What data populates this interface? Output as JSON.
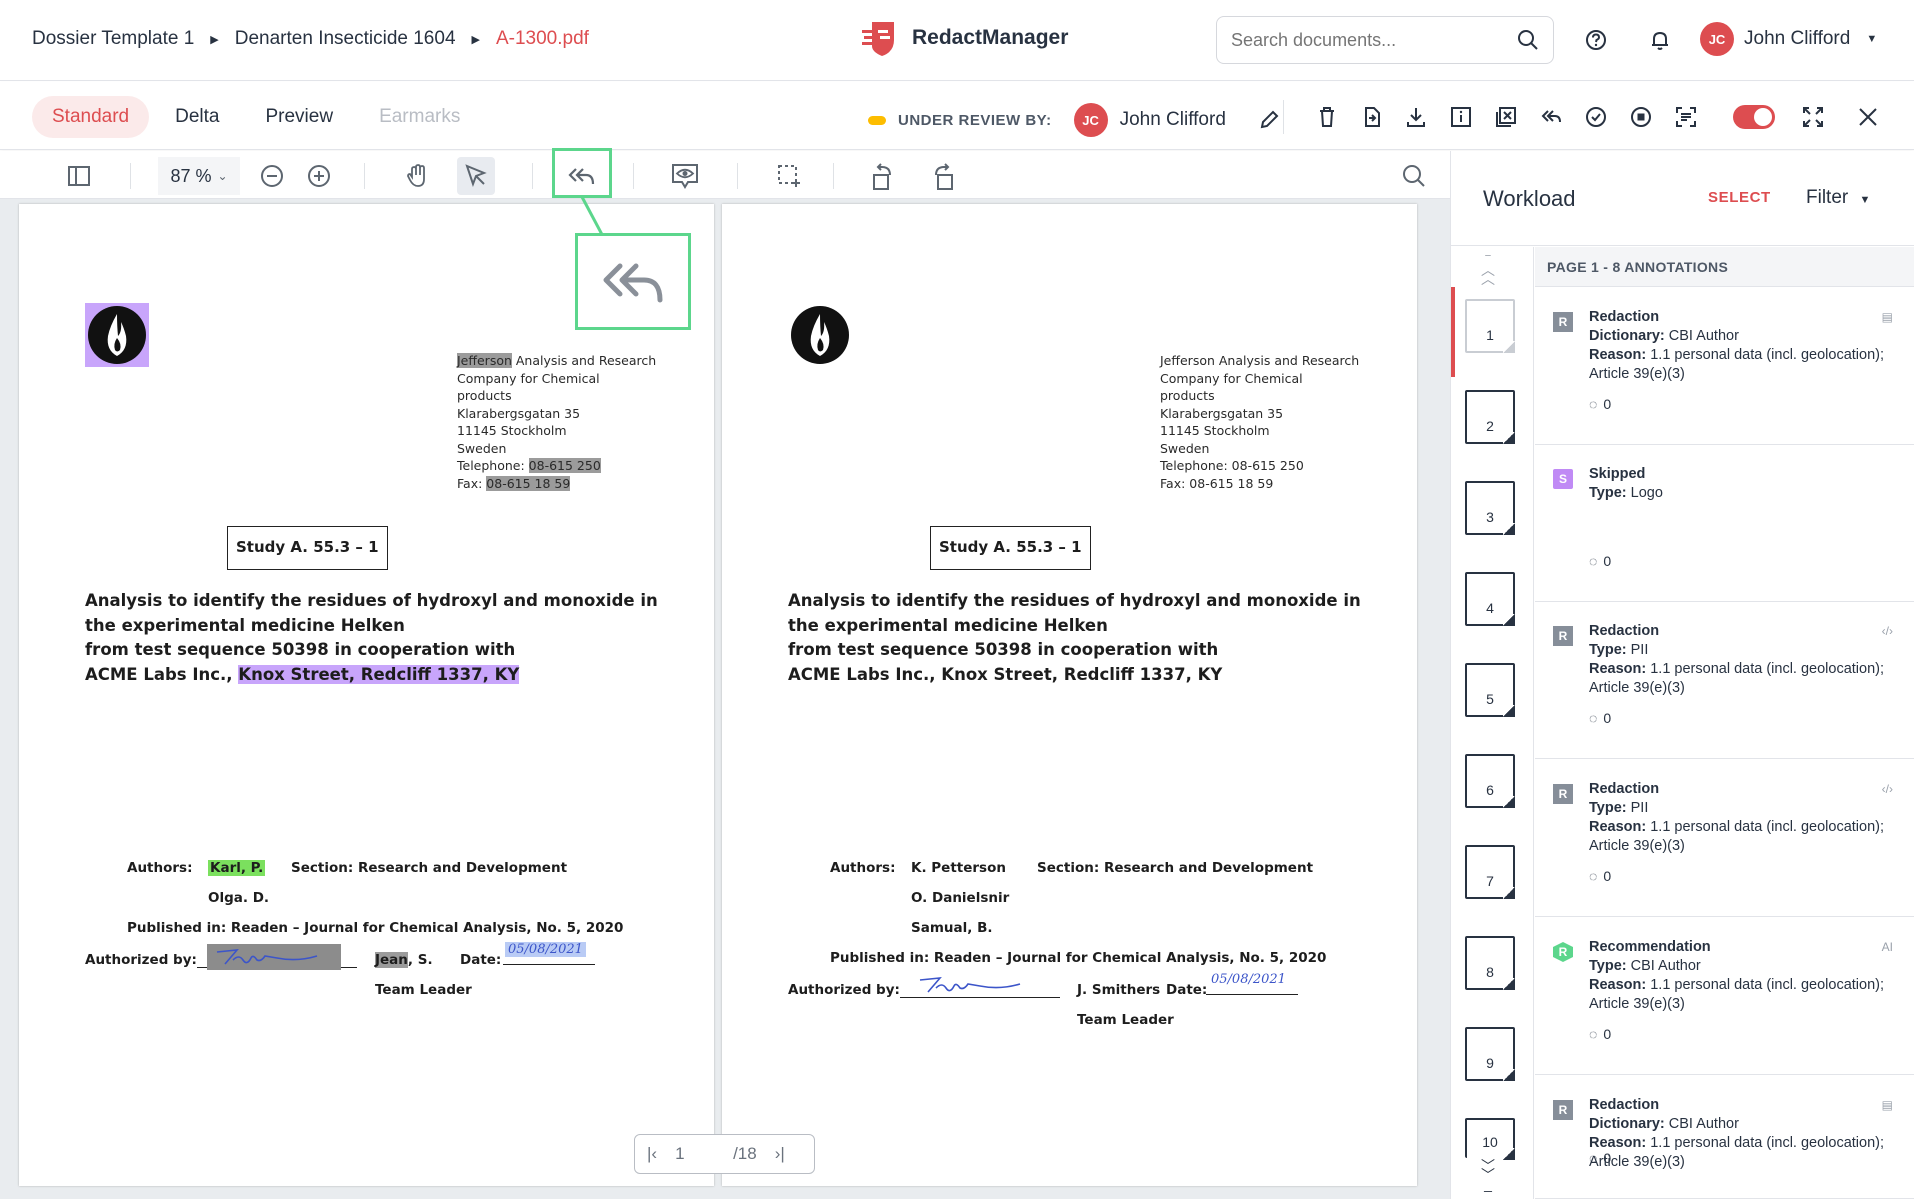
{
  "breadcrumb": {
    "items": [
      "Dossier Template 1",
      "Denarten Insecticide 1604",
      "A-1300.pdf"
    ]
  },
  "app": {
    "name": "RedactManager"
  },
  "search": {
    "placeholder": "Search documents..."
  },
  "user": {
    "initials": "JC",
    "name": "John Clifford"
  },
  "tabs": [
    "Standard",
    "Delta",
    "Preview",
    "Earmarks"
  ],
  "review": {
    "label": "UNDER REVIEW BY:",
    "initials": "JC",
    "reviewer": "John Clifford"
  },
  "viewer": {
    "zoom": "87 %"
  },
  "document": {
    "address": [
      "Jefferson",
      " Analysis and Research",
      "Company for Chemical",
      "products",
      "Klarabergsgatan 35",
      "11145 Stockholm",
      "Sweden",
      "Telephone: ",
      "08-615 250",
      "Fax: ",
      "08-615 18 59"
    ],
    "address_plain": [
      "Jefferson Analysis and Research",
      "Company for Chemical",
      "products",
      "Klarabergsgatan 35",
      "11145 Stockholm",
      "Sweden",
      "Telephone: 08-615 250",
      "Fax: 08-615 18 59"
    ],
    "study": "Study A. 55.3 – 1",
    "title_lines": [
      "Analysis to identify the residues of hydroxyl and monoxide in",
      "the experimental medicine Helken",
      "from test sequence 50398 in cooperation with"
    ],
    "title_last_prefix": "ACME Labs Inc., ",
    "title_last_highlight": "Knox Street, Redcliff 1337, KY",
    "authors_label": "Authors:",
    "section": "Section: Research and Development",
    "left_authors": [
      "Karl, P.",
      "Olga. D."
    ],
    "right_authors": [
      "K. Petterson",
      "O. Danielsnir",
      "Samual, B."
    ],
    "published": "Published in: Readen – Journal for Chemical Analysis, No. 5, 2020",
    "authorized_label": "Authorized by:",
    "left_signer_a": "Jean",
    "left_signer_b": ", S.",
    "right_signer": "J. Smithers",
    "date_label": "Date:",
    "date_value": "05/08/2021",
    "role": "Team Leader"
  },
  "pager": {
    "current": "1",
    "total": "/18"
  },
  "workload": {
    "title": "Workload",
    "select": "SELECT",
    "filter": "Filter",
    "page_header": "PAGE 1 - 8 ANNOTATIONS",
    "thumbnails": [
      "1",
      "2",
      "3",
      "4",
      "5",
      "6",
      "7",
      "8",
      "9",
      "10"
    ],
    "annotations": [
      {
        "badge": "R",
        "badge_color": "#868e99",
        "type": "Redaction",
        "k1": "Dictionary:",
        "v1": " CBI Author",
        "k2": "Reason:",
        "v2": " 1.1 personal data (incl. geolocation); Article 39(e)(3)",
        "comments": "0",
        "icon": "▤"
      },
      {
        "badge": "S",
        "badge_color": "#c08af5",
        "type": "Skipped",
        "k1": "Type:",
        "v1": " Logo",
        "k2": "",
        "v2": "",
        "comments": "0",
        "icon": ""
      },
      {
        "badge": "R",
        "badge_color": "#868e99",
        "type": "Redaction",
        "k1": "Type:",
        "v1": " PII",
        "k2": "Reason:",
        "v2": " 1.1 personal data (incl. geolocation); Article 39(e)(3)",
        "comments": "0",
        "icon": "‹/›"
      },
      {
        "badge": "R",
        "badge_color": "#868e99",
        "type": "Redaction",
        "k1": "Type:",
        "v1": " PII",
        "k2": "Reason:",
        "v2": " 1.1 personal data (incl. geolocation); Article 39(e)(3)",
        "comments": "0",
        "icon": "‹/›"
      },
      {
        "badge": "R",
        "badge_color": "#5cd68c",
        "type": "Recommendation",
        "k1": "Type:",
        "v1": " CBI Author",
        "k2": "Reason:",
        "v2": " 1.1 personal data (incl. geolocation); Article 39(e)(3)",
        "comments": "0",
        "icon": "AI"
      },
      {
        "badge": "R",
        "badge_color": "#868e99",
        "type": "Redaction",
        "k1": "Dictionary:",
        "v1": " CBI Author",
        "k2": "Reason:",
        "v2": " 1.1 personal data (incl. geolocation); Article 39(e)(3)",
        "comments": "0",
        "icon": "▤"
      }
    ]
  },
  "colors": {
    "brand": "#dd4d50",
    "highlight_callout": "#5cd68c",
    "review_status": "#fdbd00"
  }
}
